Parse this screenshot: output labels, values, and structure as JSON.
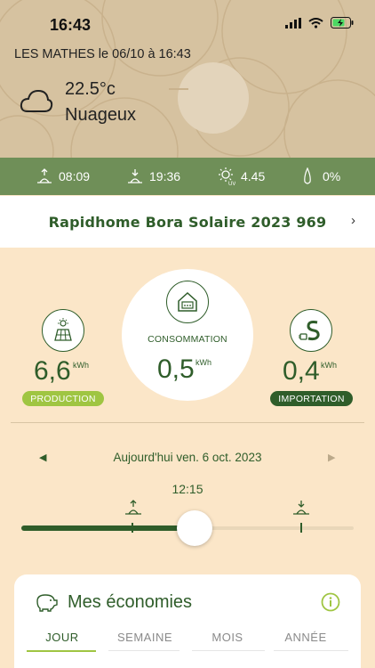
{
  "status_bar": {
    "time": "16:43"
  },
  "weather": {
    "location_line": "LES MATHES le 06/10 à 16:43",
    "temperature": "22.5°c",
    "condition": "Nuageux",
    "sunrise": "08:09",
    "sunset": "19:36",
    "uv": "4.45",
    "rain": "0%"
  },
  "device": {
    "name": "Rapidhome Bora Solaire 2023 969"
  },
  "energy": {
    "production": {
      "value": "6,6",
      "unit": "kWh",
      "label": "PRODUCTION"
    },
    "consumption": {
      "value": "0,5",
      "unit": "kWh",
      "label": "CONSOMMATION"
    },
    "importation": {
      "value": "0,4",
      "unit": "kWh",
      "label": "IMPORTATION"
    }
  },
  "timeline": {
    "date": "Aujourd'hui ven. 6 oct. 2023",
    "current_time": "12:15"
  },
  "savings": {
    "title": "Mes économies",
    "tabs": [
      "JOUR",
      "SEMAINE",
      "MOIS",
      "ANNÉE"
    ]
  },
  "colors": {
    "accent_green": "#2f5d2a",
    "light_green": "#9fc542",
    "band": "#6f8f58",
    "background": "#fbe6c8"
  }
}
